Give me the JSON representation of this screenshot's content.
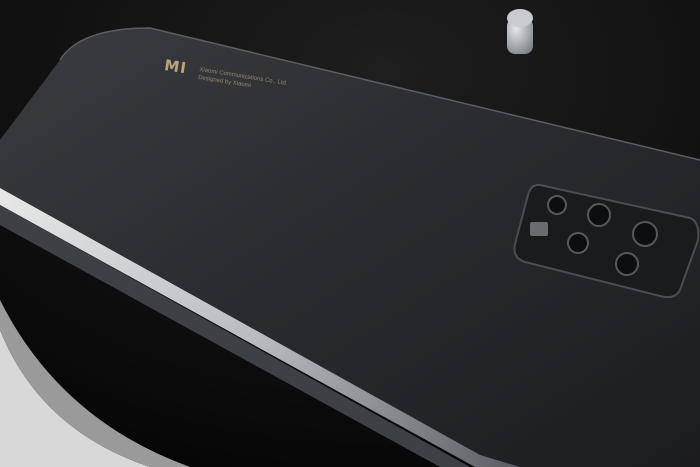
{
  "photo": {
    "description_subject": "smartphone-back",
    "logo_text": "MI",
    "line1": "Xiaomi Communications Co., Ltd.",
    "line2": "Designed by Xiaomi"
  },
  "colors": {
    "background": "#0c0c0c",
    "phone_body": "#2b2d30",
    "frame_highlight": "#d9dde2",
    "logo_gold": "#b8a77a"
  }
}
